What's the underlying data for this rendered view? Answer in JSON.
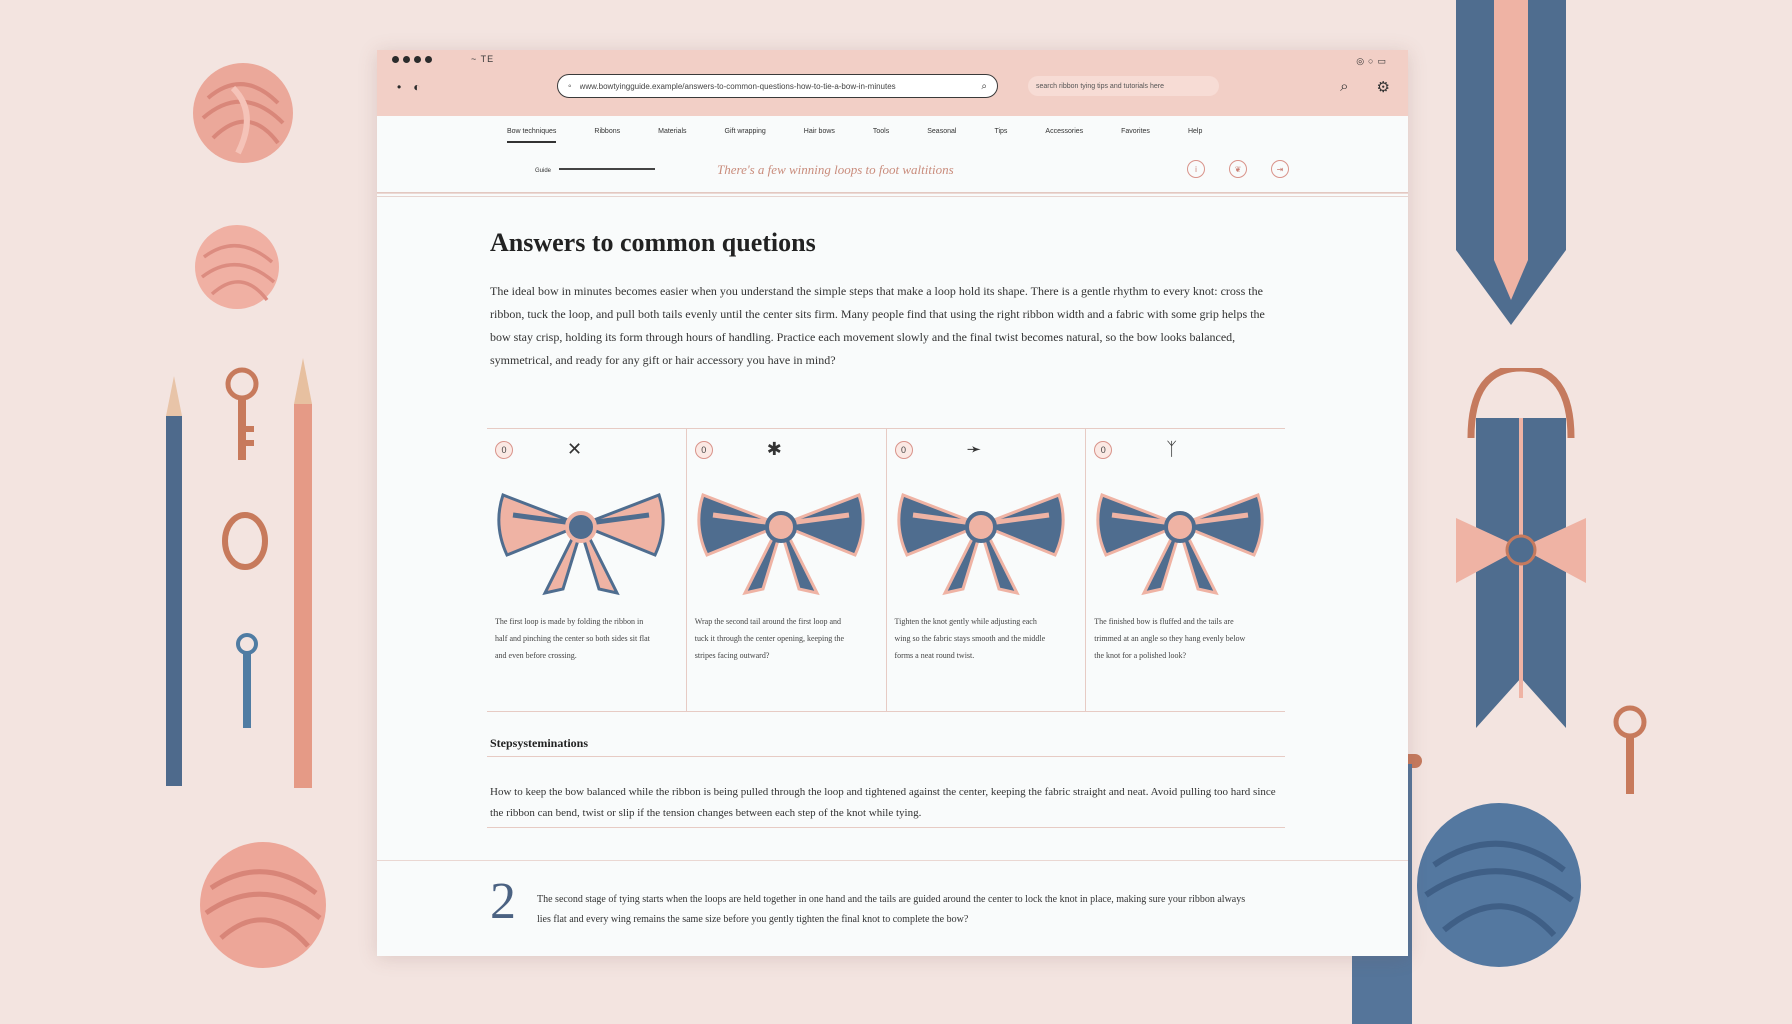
{
  "browser": {
    "topbar_label": "~ TE",
    "url_text": "www.bowtyingguide.example/answers-to-common-questions-how-to-tie-a-bow-in-minutes",
    "right_search_text": "search ribbon tying tips and tutorials here",
    "nav_back": "•",
    "nav_forward": "◐",
    "search_icon": "search-icon",
    "settings_icon": "gear-icon"
  },
  "tabs": [
    "Bow techniques",
    "Ribbons",
    "Materials",
    "Gift wrapping",
    "Hair bows",
    "Tools",
    "Seasonal",
    "Tips",
    "Accessories",
    "Favorites",
    "Help"
  ],
  "sub_label": "Guide",
  "banner": "There's a few winning loops to foot waltitions",
  "main": {
    "title": "Answers to common quetions",
    "intro": "The ideal bow in minutes becomes easier when you understand the simple steps that make a loop hold its shape. There is a gentle rhythm to every knot: cross the ribbon, tuck the loop, and pull both tails evenly until the center sits firm. Many people find that using the right ribbon width and a fabric with some grip helps the bow stay crisp, holding its form through hours of handling. Practice each movement slowly and the final twist becomes natural, so the bow looks balanced, symmetrical, and ready for any gift or hair accessory you have in mind?"
  },
  "steps": [
    {
      "num": "0",
      "mark": "✕",
      "text": "The first loop is made by folding the ribbon in half and pinching the center so both sides sit flat and even before crossing."
    },
    {
      "num": "0",
      "mark": "✱",
      "text": "Wrap the second tail around the first loop and tuck it through the center opening, keeping the stripes facing outward?"
    },
    {
      "num": "0",
      "mark": "➛",
      "text": "Tighten the knot gently while adjusting each wing so the fabric stays smooth and the middle forms a neat round twist."
    },
    {
      "num": "0",
      "mark": "ᛉ",
      "text": "The finished bow is fluffed and the tails are trimmed at an angle so they hang evenly below the knot for a polished look?"
    }
  ],
  "section2": {
    "title": "Stepsysteminations",
    "text": "How to keep the bow balanced while the ribbon is being pulled through the loop and tightened against the center, keeping the fabric straight and neat. Avoid pulling too hard since the ribbon can bend, twist or slip if the tension changes between each step of the knot while tying."
  },
  "section3": {
    "number": "2",
    "text": "The second stage of tying starts when the loops are held together in one hand and the tails are guided around the center to lock the knot in place, making sure your ribbon always lies flat and every wing remains the same size before you gently tighten the final knot to complete the bow?"
  },
  "colors": {
    "page_bg": "#f3e4e0",
    "topbar": "#f2cfc6",
    "accent_pink": "#e9a696",
    "accent_blue": "#4b6c90",
    "number_blue": "#4b6282"
  }
}
